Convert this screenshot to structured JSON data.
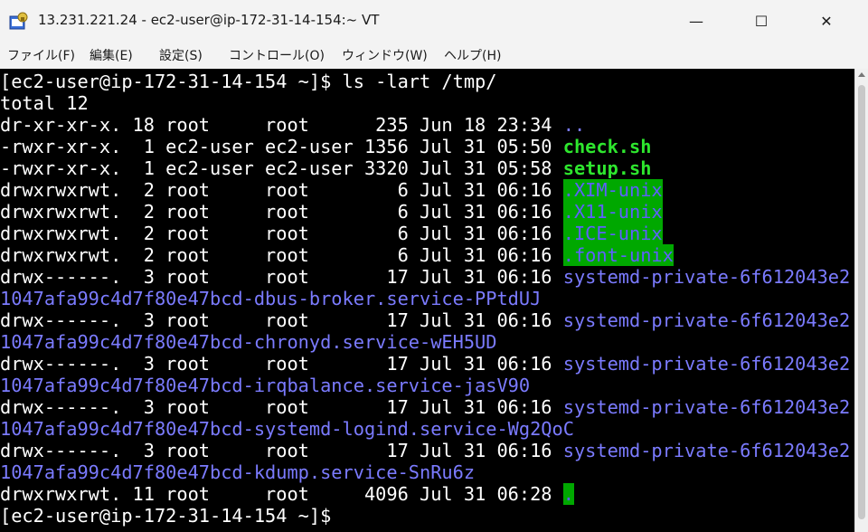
{
  "window": {
    "title": "13.231.221.24 - ec2-user@ip-172-31-14-154:~ VT",
    "icon": "lock-terminal-icon",
    "minimize_glyph": "—",
    "maximize_glyph": "☐",
    "close_glyph": "✕"
  },
  "menu": [
    {
      "label": "ファイル(F)"
    },
    {
      "label": "編集(E)"
    },
    {
      "label": "設定(S)"
    },
    {
      "label": "コントロール(O)"
    },
    {
      "label": "ウィンドウ(W)"
    },
    {
      "label": "ヘルプ(H)"
    }
  ],
  "terminal": {
    "prompt_cmd": "[ec2-user@ip-172-31-14-154 ~]$ ls -lart /tmp/",
    "total": "total 12",
    "rows": [
      {
        "prefix": "dr-xr-xr-x. 18 root     root      235 Jun 18 23:34 ",
        "name": ".."
      },
      {
        "prefix": "-rwxr-xr-x.  1 ec2-user ec2-user 1356 Jul 31 05:50 ",
        "name": "check.sh"
      },
      {
        "prefix": "-rwxr-xr-x.  1 ec2-user ec2-user 3320 Jul 31 05:58 ",
        "name": "setup.sh"
      },
      {
        "prefix": "drwxrwxrwt.  2 root     root        6 Jul 31 06:16 ",
        "name": ".XIM-unix"
      },
      {
        "prefix": "drwxrwxrwt.  2 root     root        6 Jul 31 06:16 ",
        "name": ".X11-unix"
      },
      {
        "prefix": "drwxrwxrwt.  2 root     root        6 Jul 31 06:16 ",
        "name": ".ICE-unix"
      },
      {
        "prefix": "drwxrwxrwt.  2 root     root        6 Jul 31 06:16 ",
        "name": ".font-unix"
      },
      {
        "prefix": "drwx------.  3 root     root       17 Jul 31 06:16 ",
        "name": "systemd-private-6f612043e2"
      },
      {
        "prefix": "",
        "name": "1047afa99c4d7f80e47bcd-dbus-broker.service-PPtdUJ"
      },
      {
        "prefix": "drwx------.  3 root     root       17 Jul 31 06:16 ",
        "name": "systemd-private-6f612043e2"
      },
      {
        "prefix": "",
        "name": "1047afa99c4d7f80e47bcd-chronyd.service-wEH5UD"
      },
      {
        "prefix": "drwx------.  3 root     root       17 Jul 31 06:16 ",
        "name": "systemd-private-6f612043e2"
      },
      {
        "prefix": "",
        "name": "1047afa99c4d7f80e47bcd-irqbalance.service-jasV90"
      },
      {
        "prefix": "drwx------.  3 root     root       17 Jul 31 06:16 ",
        "name": "systemd-private-6f612043e2"
      },
      {
        "prefix": "",
        "name": "1047afa99c4d7f80e47bcd-systemd-logind.service-Wg2QoC"
      },
      {
        "prefix": "drwx------.  3 root     root       17 Jul 31 06:16 ",
        "name": "systemd-private-6f612043e2"
      },
      {
        "prefix": "",
        "name": "1047afa99c4d7f80e47bcd-kdump.service-SnRu6z"
      },
      {
        "prefix": "drwxrwxrwt. 11 root     root     4096 Jul 31 06:28 ",
        "name": "."
      }
    ],
    "last_prompt": "[ec2-user@ip-172-31-14-154 ~]$ "
  },
  "colors": {
    "terminal_bg": "#000000",
    "text": "#ffffff",
    "dir_blue": "#7b7bff",
    "exec_green": "#2ee62e",
    "sticky_highlight": "#00a800"
  }
}
